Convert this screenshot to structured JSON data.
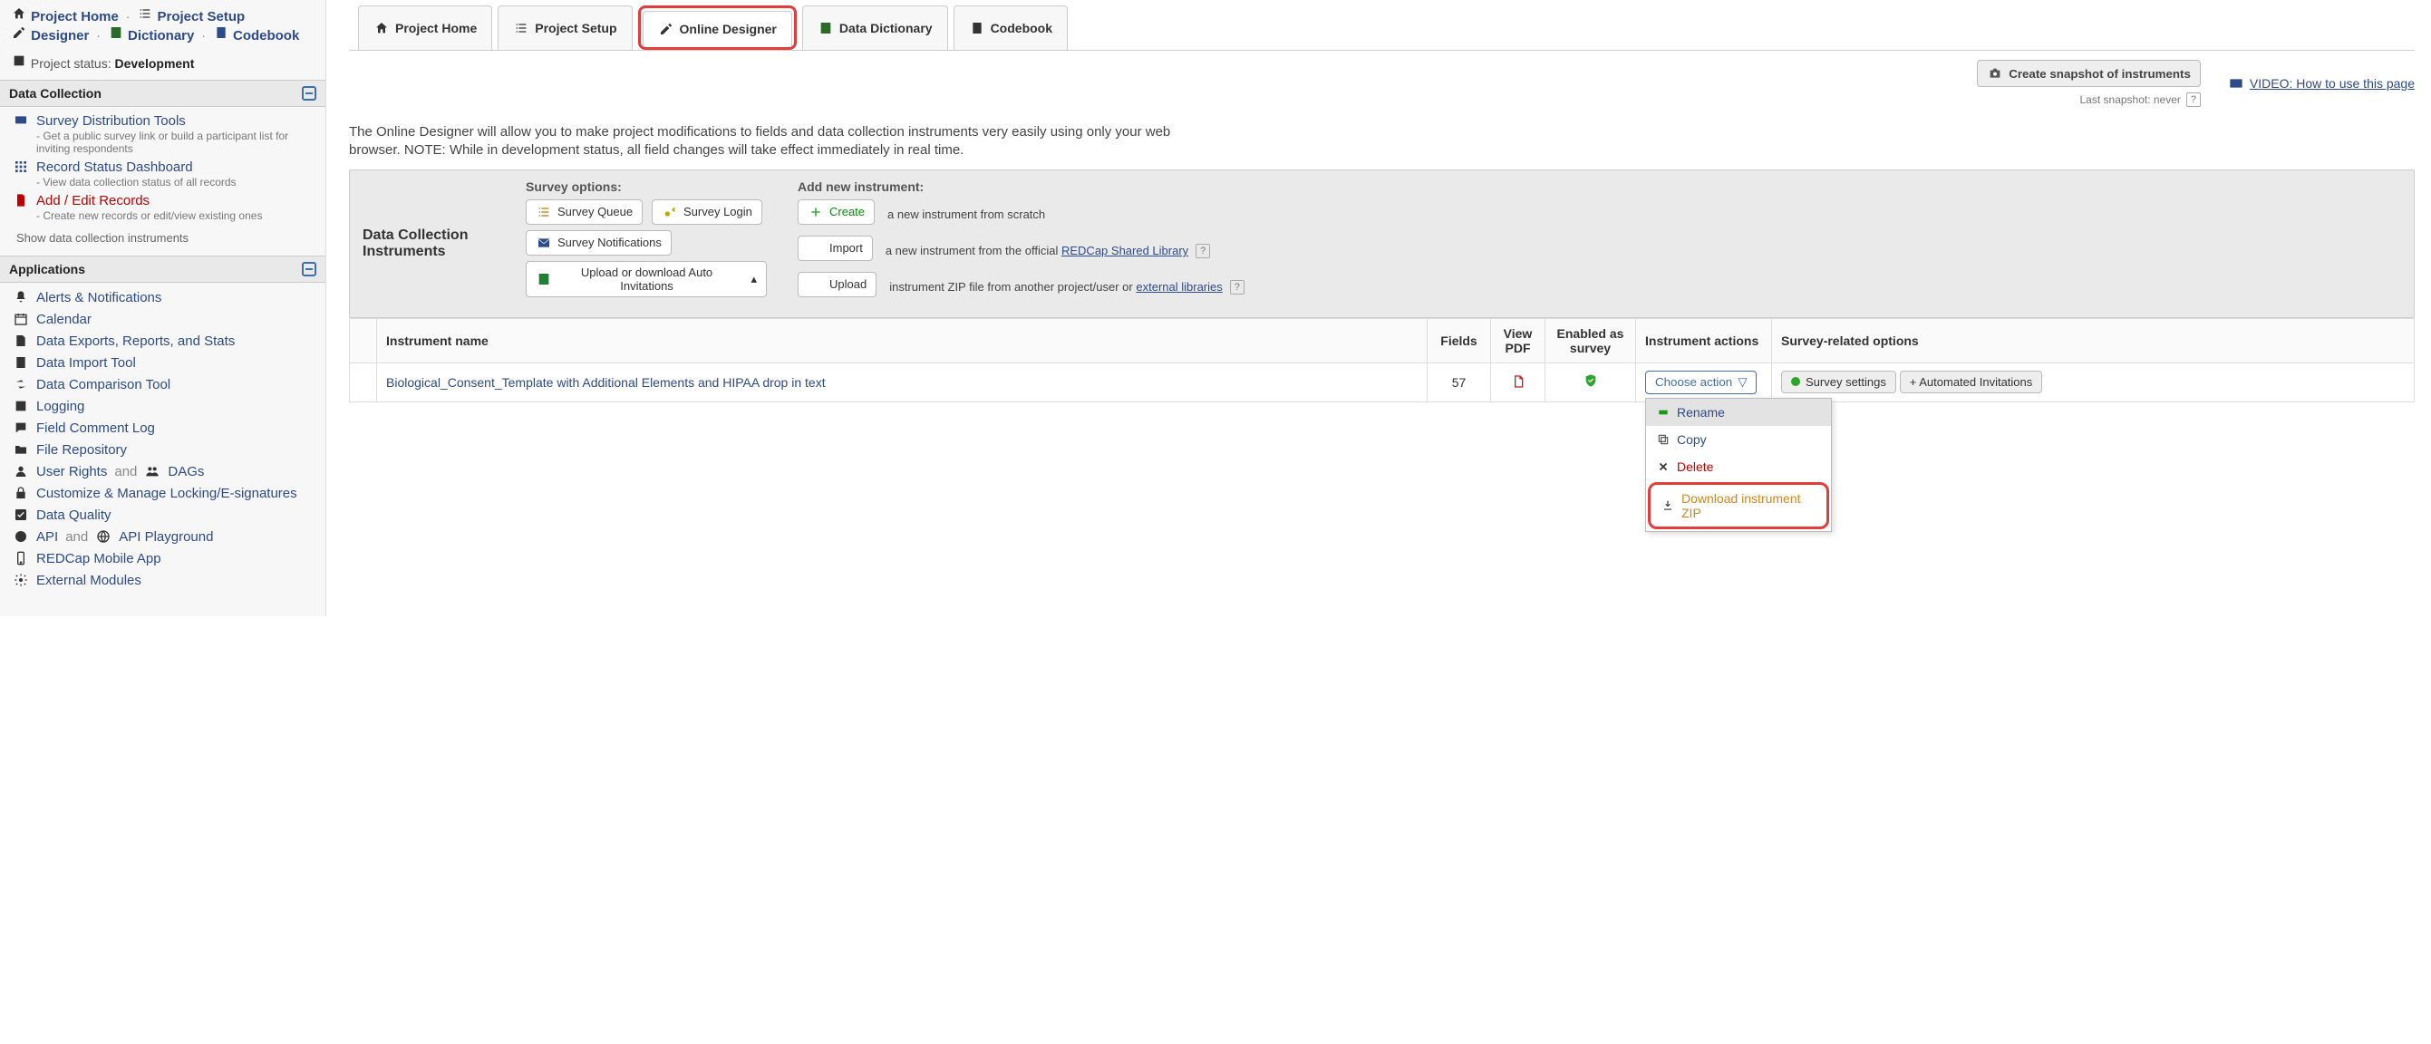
{
  "sidebar": {
    "top": {
      "home": "Project Home",
      "setup": "Project Setup",
      "designer": "Designer",
      "dictionary": "Dictionary",
      "codebook": "Codebook"
    },
    "status_label": "Project status:",
    "status_value": "Development",
    "sections": {
      "dc": "Data Collection",
      "apps": "Applications"
    },
    "dc_items": [
      {
        "title": "Survey Distribution Tools",
        "desc": "- Get a public survey link or build a participant list for inviting respondents"
      },
      {
        "title": "Record Status Dashboard",
        "desc": "- View data collection status of all records"
      },
      {
        "title": "Add / Edit Records",
        "desc": "- Create new records or edit/view existing ones"
      }
    ],
    "dc_note": "Show data collection instruments",
    "apps": [
      "Alerts & Notifications",
      "Calendar",
      "Data Exports, Reports, and Stats",
      "Data Import Tool",
      "Data Comparison Tool",
      "Logging",
      "Field Comment Log",
      "File Repository"
    ],
    "user_rights": "User Rights",
    "and": "and",
    "dags": "DAGs",
    "lock": "Customize & Manage Locking/E-signatures",
    "dq": "Data Quality",
    "api": "API",
    "apipg": "API Playground",
    "mobile": "REDCap Mobile App",
    "ext": "External Modules"
  },
  "tabs": {
    "home": "Project Home",
    "setup": "Project Setup",
    "online": "Online Designer",
    "dict": "Data Dictionary",
    "codebook": "Codebook"
  },
  "snapshot": {
    "btn": "Create snapshot of instruments",
    "note": "Last snapshot: never"
  },
  "video": "VIDEO: How to use this page",
  "description": "The Online Designer will allow you to make project modifications to fields and data collection instruments very easily using only your web browser. NOTE: While in development status, all field changes will take effect immediately in real time.",
  "panel": {
    "title": "Data Collection Instruments",
    "survey_h": "Survey options:",
    "queue": "Survey Queue",
    "login": "Survey Login",
    "notif": "Survey Notifications",
    "auto": "Upload or download Auto Invitations",
    "add_h": "Add new instrument:",
    "create": "Create",
    "create_t": "a new instrument from scratch",
    "import": "Import",
    "import_t": "a new instrument from the official",
    "import_l": "REDCap Shared Library",
    "upload": "Upload",
    "upload_t": "instrument ZIP file from another project/user or",
    "upload_l": "external libraries"
  },
  "table": {
    "h": {
      "name": "Instrument name",
      "fields": "Fields",
      "pdf": "View PDF",
      "survey": "Enabled as survey",
      "actions": "Instrument actions",
      "sopts": "Survey-related options"
    },
    "row": {
      "name": "Biological_Consent_Template with Additional Elements and HIPAA drop in text",
      "fields": "57",
      "choose": "Choose action",
      "ss": "Survey settings",
      "auto": "+ Automated Invitations"
    }
  },
  "menu": {
    "rename": "Rename",
    "copy": "Copy",
    "delete": "Delete",
    "zip": "Download instrument ZIP"
  }
}
